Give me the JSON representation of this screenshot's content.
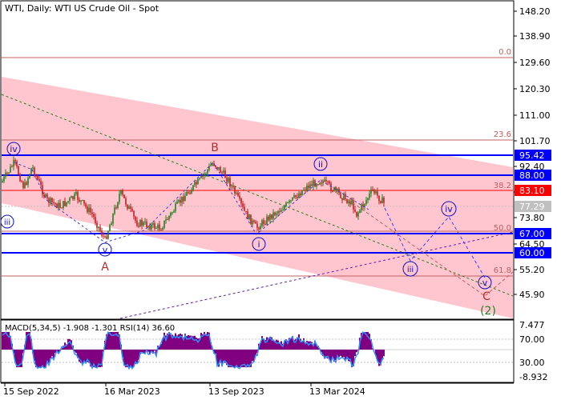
{
  "header": {
    "title": "WTI, Daily:  WTI US Crude Oil - Spot"
  },
  "main_axis": {
    "ticks": [
      "148.20",
      "138.90",
      "129.60",
      "120.30",
      "111.00",
      "101.70",
      "92.40",
      "83.10",
      "73.80",
      "64.50",
      "55.20",
      "45.90"
    ]
  },
  "price_tags": [
    {
      "label": "95.42",
      "color": "#0000ff"
    },
    {
      "label": "88.00",
      "color": "#0000ff"
    },
    {
      "label": "83.10",
      "color": "#ff0000"
    },
    {
      "label": "77.29",
      "color": "#c0c0c0"
    },
    {
      "label": "67.00",
      "color": "#0000ff"
    },
    {
      "label": "60.00",
      "color": "#0000ff"
    }
  ],
  "fib_labels": [
    {
      "label": "0.0"
    },
    {
      "label": "23.6"
    },
    {
      "label": "38.2"
    },
    {
      "label": "50.0"
    },
    {
      "label": "61.8"
    }
  ],
  "wave_labels": {
    "iv_top": "iv",
    "iii_left": "iii",
    "v_low": "v",
    "A": "A",
    "B": "B",
    "i": "i",
    "ii": "ii",
    "iii_proj": "iii",
    "iv_proj": "iv",
    "v_proj": "v",
    "C": "C",
    "two": "(2)"
  },
  "indicator": {
    "title": "MACD(5,34,5) -1.908 -1.301 RSI(14) 36.60",
    "ticks": [
      "7.477",
      "70.00",
      "30.00",
      "-8.932"
    ]
  },
  "x_axis": {
    "labels": [
      "15 Sep 2022",
      "16 Mar 2023",
      "13 Sep 2023",
      "13 Mar 2024"
    ]
  },
  "colors": {
    "channel_fill": "#ffc0cb",
    "support_resistance": "#0000ff",
    "fib_line": "#c06060",
    "wave_label_blue": "#1010c0",
    "wave_label_red": "#b03030",
    "wave_label_green": "#208020",
    "up_candle": "#208020",
    "down_candle": "#c02020",
    "macd_hist": "#800080",
    "rsi_line": "#3090ff"
  }
}
